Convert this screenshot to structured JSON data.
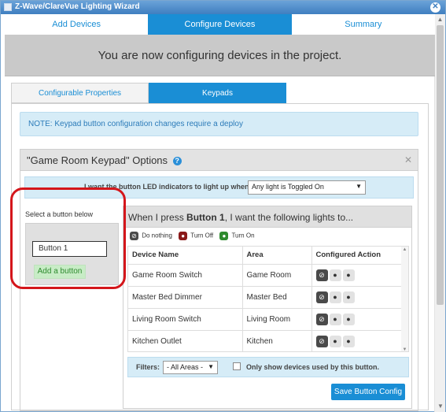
{
  "window": {
    "title": "Z-Wave/ClareVue Lighting Wizard"
  },
  "top_tabs": [
    {
      "label": "Add Devices"
    },
    {
      "label": "Configure Devices"
    },
    {
      "label": "Summary"
    }
  ],
  "banner": {
    "text": "You are now configuring devices in the project."
  },
  "sub_tabs": [
    {
      "label": "Configurable Properties"
    },
    {
      "label": "Keypads"
    }
  ],
  "note": {
    "text": "NOTE: Keypad button configuration changes require a deploy"
  },
  "options": {
    "title": "\"Game Room Keypad\" Options",
    "led_label": "I want the button LED indicators to light up when...",
    "led_value": "Any light is Toggled On"
  },
  "left_pane": {
    "title": "Select a button below",
    "button_value": "Button 1",
    "add_button": "Add a button"
  },
  "right_pane": {
    "header_prefix": "When I press",
    "header_button": "Button 1",
    "header_suffix": ", I want the following lights to...",
    "legend": [
      {
        "label": "Do nothing",
        "icon": "prohibited-icon",
        "color": "#4a4a4a"
      },
      {
        "label": "Turn Off",
        "icon": "bulb-icon",
        "color": "#8b1a1a"
      },
      {
        "label": "Turn On",
        "icon": "bulb-icon",
        "color": "#2e8b2e"
      }
    ],
    "columns": [
      "Device Name",
      "Area",
      "Configured Action"
    ],
    "rows": [
      {
        "device": "Game Room Switch",
        "area": "Game Room"
      },
      {
        "device": "Master Bed Dimmer",
        "area": "Master Bed"
      },
      {
        "device": "Living Room Switch",
        "area": "Living Room"
      },
      {
        "device": "Kitchen Outlet",
        "area": "Kitchen"
      }
    ],
    "filters_label": "Filters:",
    "area_filter": "- All Areas -",
    "only_used_label": "Only show devices used by this button.",
    "save_label": "Save Button Config"
  }
}
